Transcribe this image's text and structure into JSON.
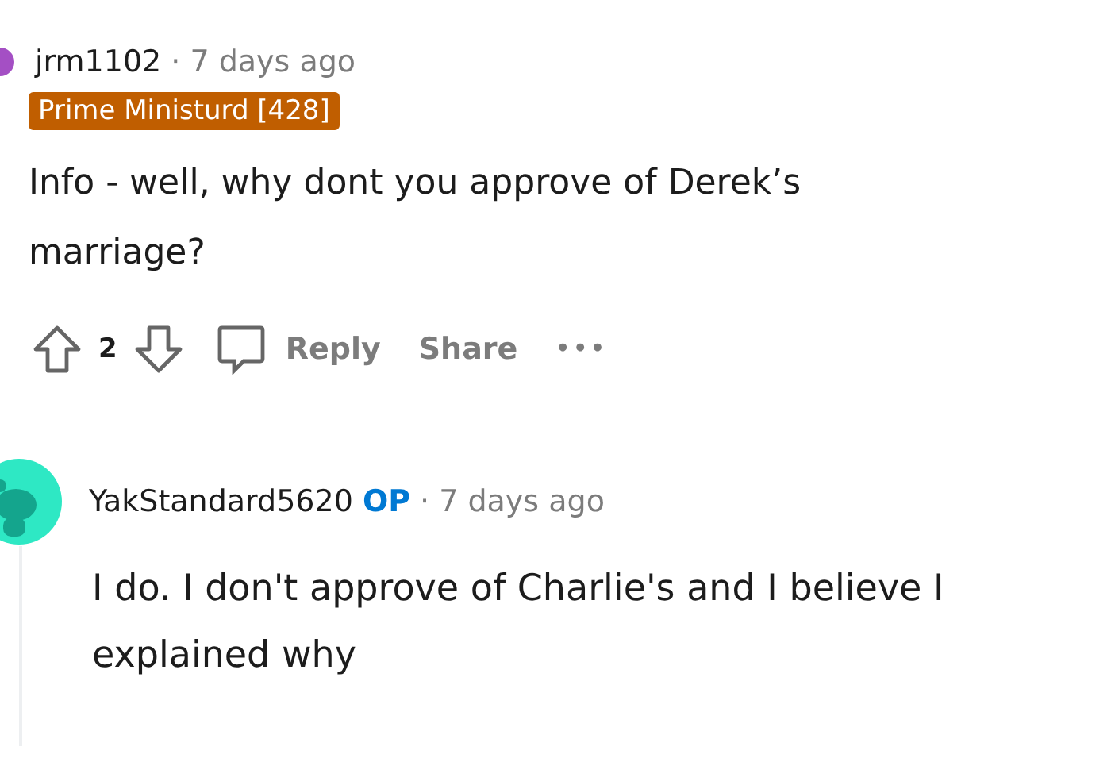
{
  "comments": [
    {
      "author": "jrm1102",
      "time": "· 7 days ago",
      "flair": "Prime Ministurd [428]",
      "body_lines": [
        "Info - well, why dont you approve of Derek’s",
        "marriage?"
      ],
      "score": "2",
      "actions": [
        "Reply",
        "Share"
      ],
      "more": "•••",
      "avatar": {
        "kind": "plain"
      }
    },
    {
      "author": "YakStandard5620",
      "op_badge": "OP",
      "time": "· 7 days ago",
      "body_lines": [
        "I do. I don't approve of Charlie's and I believe I",
        "explained why"
      ],
      "avatar": {
        "kind": "snoo"
      }
    }
  ]
}
